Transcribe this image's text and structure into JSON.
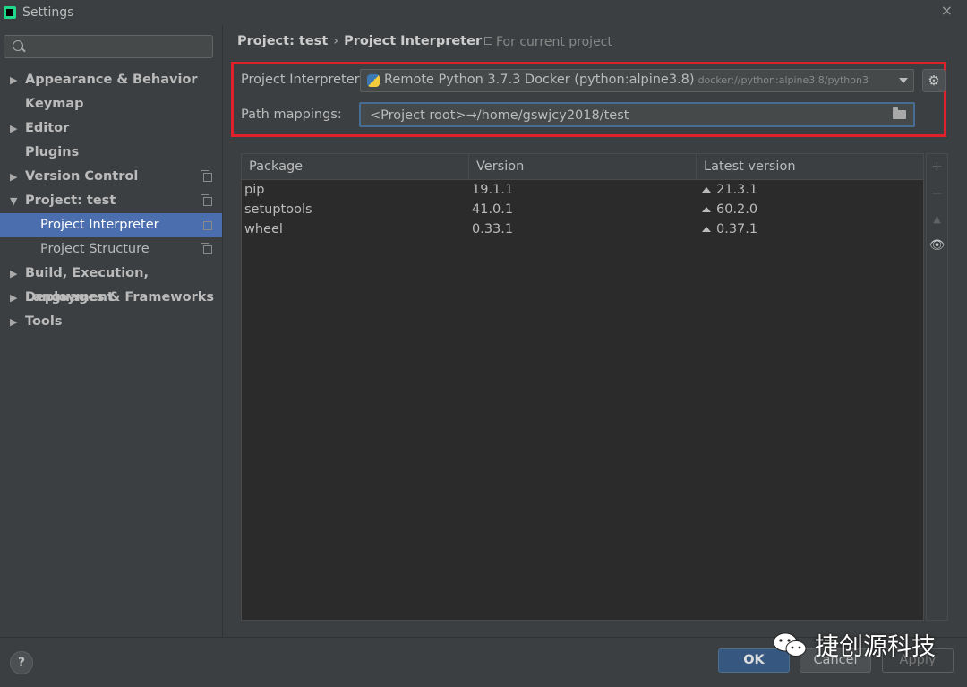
{
  "window": {
    "title": "Settings",
    "close_label": "×"
  },
  "search": {
    "placeholder": ""
  },
  "sidebar": {
    "items": [
      {
        "label": "Appearance & Behavior",
        "arrow": "▶"
      },
      {
        "label": "Keymap",
        "arrow": ""
      },
      {
        "label": "Editor",
        "arrow": "▶"
      },
      {
        "label": "Plugins",
        "arrow": ""
      },
      {
        "label": "Version Control",
        "arrow": "▶"
      },
      {
        "label": "Project: test",
        "arrow": "▼"
      },
      {
        "label": "Project Interpreter",
        "arrow": ""
      },
      {
        "label": "Project Structure",
        "arrow": ""
      },
      {
        "label": "Build, Execution, Deployment",
        "arrow": "▶"
      },
      {
        "label": "Languages & Frameworks",
        "arrow": "▶"
      },
      {
        "label": "Tools",
        "arrow": "▶"
      }
    ]
  },
  "breadcrumb": {
    "parent": "Project: test",
    "separator": "›",
    "current": "Project Interpreter"
  },
  "for_current_project": "For current project",
  "interpreter": {
    "label": "Project Interpreter:",
    "name": "Remote Python 3.7.3 Docker (python:alpine3.8)",
    "path": "docker://python:alpine3.8/python3"
  },
  "path_mappings": {
    "label": "Path mappings:",
    "value": "<Project root>→/home/gswjcy2018/test"
  },
  "table": {
    "headers": {
      "package": "Package",
      "version": "Version",
      "latest": "Latest version"
    },
    "rows": [
      {
        "package": "pip",
        "version": "19.1.1",
        "latest": "21.3.1"
      },
      {
        "package": "setuptools",
        "version": "41.0.1",
        "latest": "60.2.0"
      },
      {
        "package": "wheel",
        "version": "0.33.1",
        "latest": "0.37.1"
      }
    ]
  },
  "tools": {
    "add": "+",
    "remove": "−",
    "upgrade": "▲",
    "eye": "👁"
  },
  "footer": {
    "help": "?",
    "ok": "OK",
    "cancel": "Cancel",
    "apply": "Apply"
  },
  "watermark": {
    "text": "捷创源科技"
  },
  "colors": {
    "accent": "#4b6eaf",
    "highlight_border": "#e0202a",
    "ok_button": "#365880"
  }
}
